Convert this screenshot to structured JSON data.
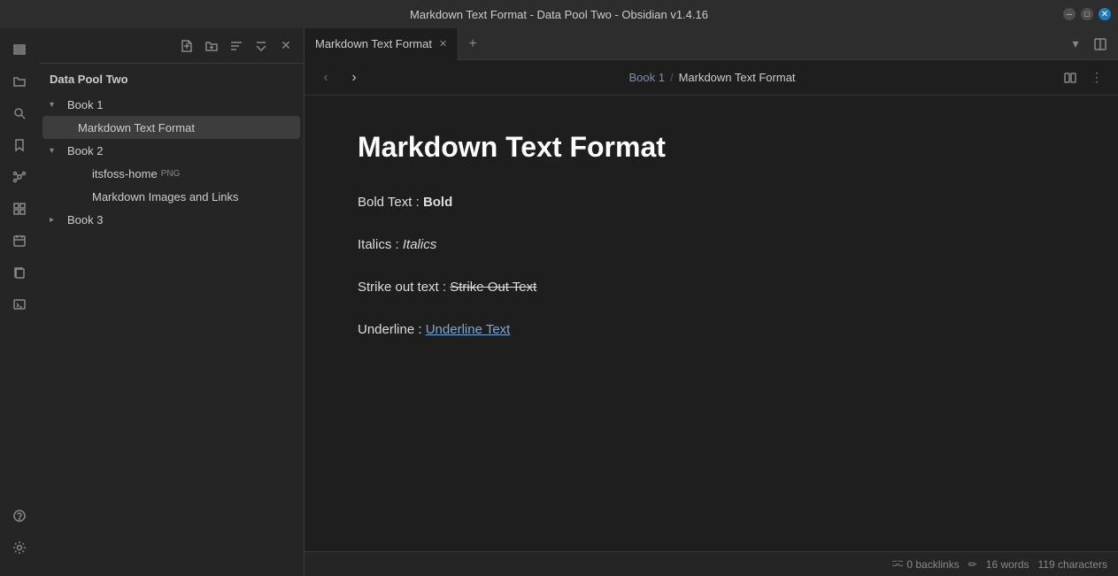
{
  "titlebar": {
    "title": "Markdown Text Format - Data Pool Two - Obsidian v1.4.16"
  },
  "sidebar": {
    "title": "Data Pool Two",
    "tree": [
      {
        "id": "book1",
        "label": "Book 1",
        "type": "folder",
        "expanded": true,
        "indent": 0
      },
      {
        "id": "markdown-text",
        "label": "Markdown Text Format",
        "type": "file",
        "indent": 1,
        "active": true
      },
      {
        "id": "book2",
        "label": "Book 2",
        "type": "folder",
        "expanded": true,
        "indent": 0
      },
      {
        "id": "itsfoss-home",
        "label": "itsfoss-home",
        "type": "image",
        "badge": "PNG",
        "indent": 1
      },
      {
        "id": "markdown-images",
        "label": "Markdown Images and Links",
        "type": "file",
        "indent": 1
      },
      {
        "id": "book3",
        "label": "Book 3",
        "type": "folder",
        "expanded": false,
        "indent": 0
      }
    ]
  },
  "tabs": [
    {
      "id": "markdown-text-tab",
      "label": "Markdown Text Format",
      "active": true
    }
  ],
  "breadcrumb": {
    "parent": "Book 1",
    "separator": "/",
    "current": "Markdown Text Format"
  },
  "document": {
    "title": "Markdown Text Format",
    "paragraphs": [
      {
        "prefix": "Bold Text : ",
        "bold": "Bold",
        "suffix": ""
      },
      {
        "prefix": "Italics : ",
        "italic": "Italics",
        "suffix": ""
      },
      {
        "prefix": "Strike out text : ",
        "strike": "Strike Out Text",
        "suffix": ""
      },
      {
        "prefix": "Underline : ",
        "underline": "Underline Text",
        "suffix": ""
      }
    ]
  },
  "statusbar": {
    "backlinks": "0 backlinks",
    "words": "16 words",
    "characters": "119 characters"
  },
  "icons": {
    "chevron_down": "▾",
    "chevron_right": "▸",
    "folder": "📁",
    "file": "📄",
    "close": "✕",
    "plus": "+",
    "arrow_left": "‹",
    "arrow_right": "›",
    "more": "⋮",
    "reading_view": "⧉",
    "edit": "✎",
    "pencil": "✏"
  }
}
